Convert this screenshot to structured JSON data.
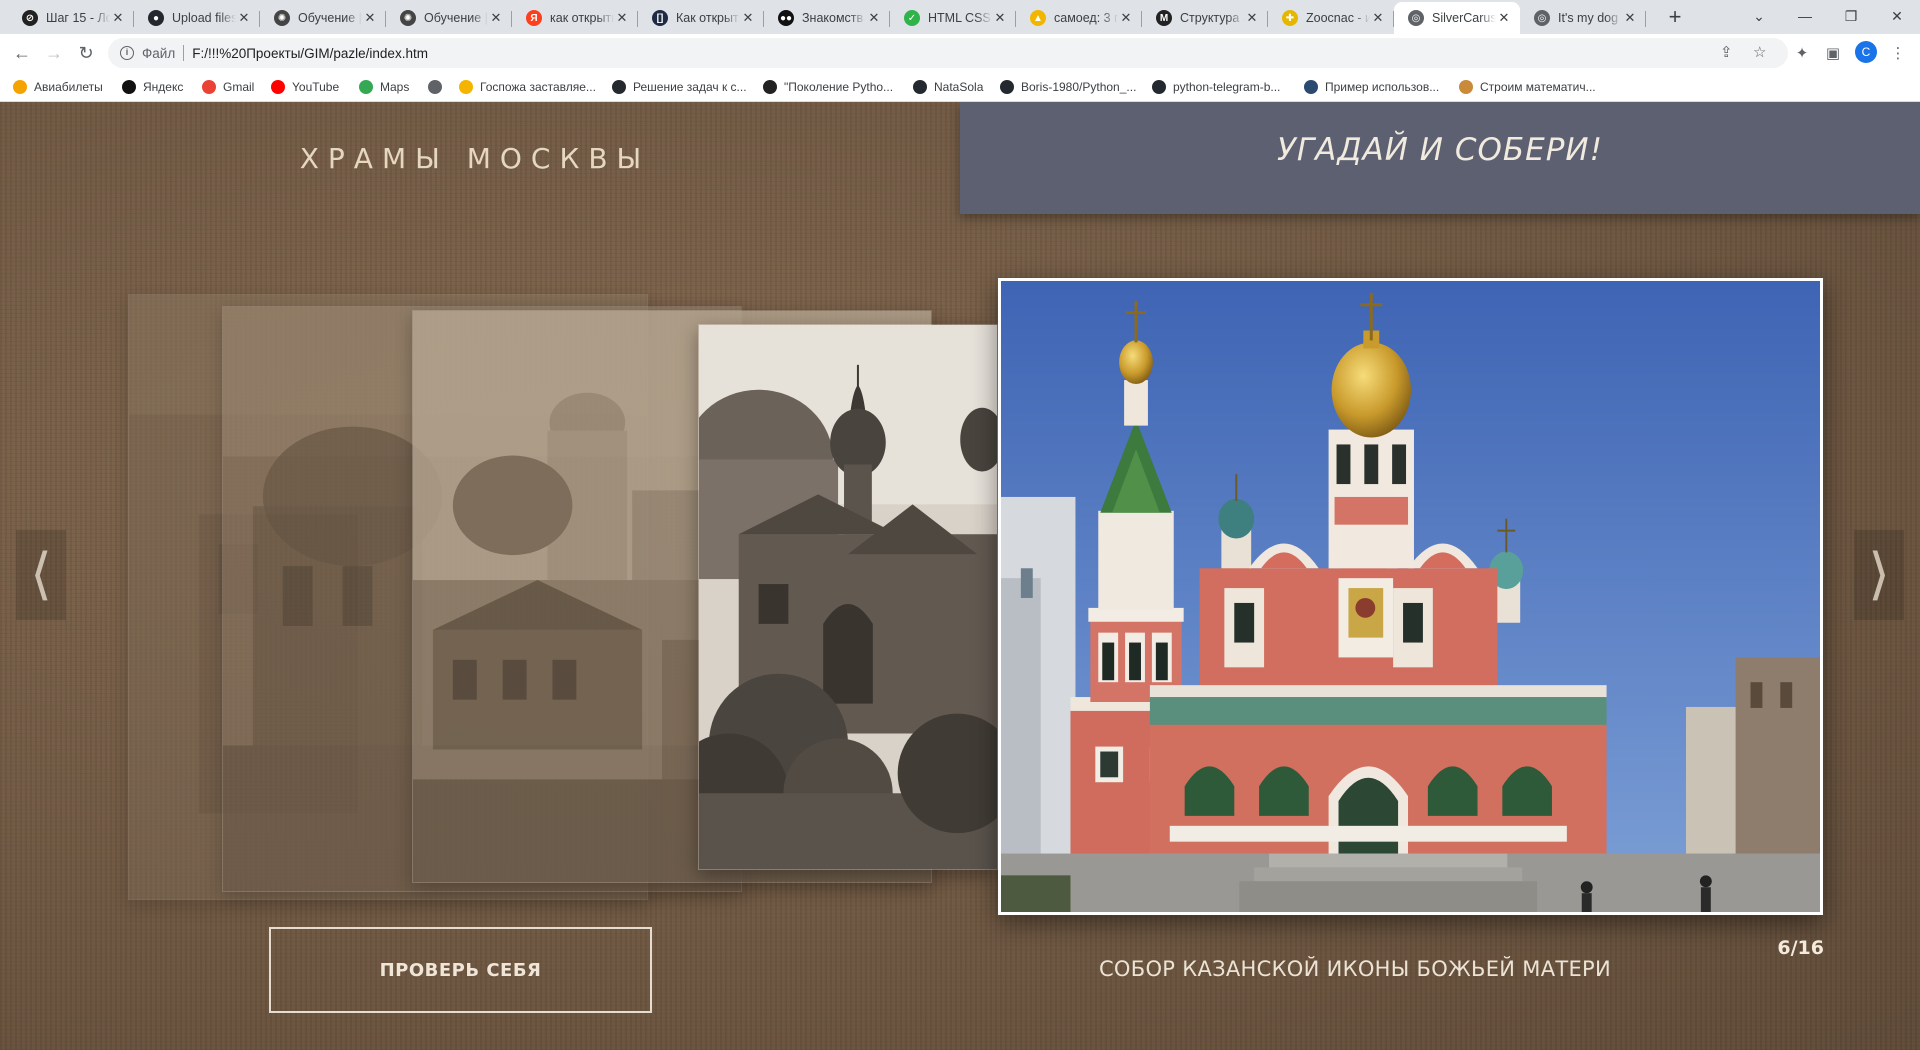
{
  "browser": {
    "tabs": [
      {
        "title": "Шаг 15 - Ло",
        "favicon": "stepik-icon",
        "color": "#222222",
        "glyph": "⊘"
      },
      {
        "title": "Upload files",
        "favicon": "github-icon",
        "color": "#24292f",
        "glyph": "●"
      },
      {
        "title": "Обучение |",
        "favicon": "openai-icon",
        "color": "#444444",
        "glyph": "✺"
      },
      {
        "title": "Обучение |",
        "favicon": "openai-icon",
        "color": "#444444",
        "glyph": "✺"
      },
      {
        "title": "как открыть",
        "favicon": "yandex-icon",
        "color": "#fc3f1d",
        "glyph": "Я"
      },
      {
        "title": "Как открыть",
        "favicon": "bracket-icon",
        "color": "#1f2a44",
        "glyph": "[]"
      },
      {
        "title": "Знакомств",
        "favicon": "medium-icon",
        "color": "#111111",
        "glyph": "●●"
      },
      {
        "title": "HTML CSS /",
        "favicon": "check-icon",
        "color": "#2fb34a",
        "glyph": "✓"
      },
      {
        "title": "самоед: 3 п",
        "favicon": "image-icon",
        "color": "#f2b600",
        "glyph": "▲"
      },
      {
        "title": "Структура /",
        "favicon": "m-icon",
        "color": "#222222",
        "glyph": "M"
      },
      {
        "title": "Zoocnac - и",
        "favicon": "zoo-icon",
        "color": "#e5b700",
        "glyph": "✚"
      },
      {
        "title": "SilverCarus",
        "favicon": "globe-icon",
        "color": "#5f6368",
        "glyph": "◎"
      },
      {
        "title": "It's my dog",
        "favicon": "globe-icon",
        "color": "#5f6368",
        "glyph": "◎"
      }
    ],
    "active_tab_index": 11,
    "address": {
      "scheme_label": "Файл",
      "url": "F:/!!!%20Проекты/GIM/pazle/index.htm"
    },
    "bookmarks": [
      {
        "label": "Авиабилеты",
        "favicon": "plane-icon",
        "color": "#f4a300"
      },
      {
        "label": "Яндекс",
        "favicon": "yandex-icon",
        "color": "#111111"
      },
      {
        "label": "Gmail",
        "favicon": "gmail-icon",
        "color": "#ea4335"
      },
      {
        "label": "YouTube",
        "favicon": "youtube-icon",
        "color": "#ff0000"
      },
      {
        "label": "Maps",
        "favicon": "maps-icon",
        "color": "#34a853"
      },
      {
        "label": "",
        "favicon": "globe-icon",
        "color": "#5f6368"
      },
      {
        "label": "Госпожа заставляе...",
        "favicon": "play-icon",
        "color": "#f4b400"
      },
      {
        "label": "Решение задач к с...",
        "favicon": "github-icon",
        "color": "#24292f"
      },
      {
        "label": "\"Поколение Pytho...",
        "favicon": "stepik-icon",
        "color": "#222222"
      },
      {
        "label": "NataSola",
        "favicon": "github-icon",
        "color": "#24292f"
      },
      {
        "label": "Boris-1980/Python_...",
        "favicon": "github-icon",
        "color": "#24292f"
      },
      {
        "label": "python-telegram-b...",
        "favicon": "github-icon",
        "color": "#24292f"
      },
      {
        "label": "Пример использов...",
        "favicon": "book-icon",
        "color": "#2b4a70"
      },
      {
        "label": "Строим математич...",
        "favicon": "person-icon",
        "color": "#c98a3a"
      }
    ]
  },
  "page": {
    "site_title": "ХРАМЫ МОСКВЫ",
    "slogan": "УГАДАЙ И СОБЕРИ!",
    "check_button": "ПРОВЕРЬ СЕБЯ",
    "caption": "СОБОР КАЗАНСКОЙ ИКОНЫ БОЖЬЕЙ МАТЕРИ",
    "counter": "6/16",
    "slide_index": 6,
    "slide_total": 16,
    "prev_arrow": "⟨",
    "next_arrow": "⟩",
    "colors": {
      "background": "#6f5842",
      "slogan_box": "#5d6070",
      "title_text": "#e6d7c0"
    }
  }
}
